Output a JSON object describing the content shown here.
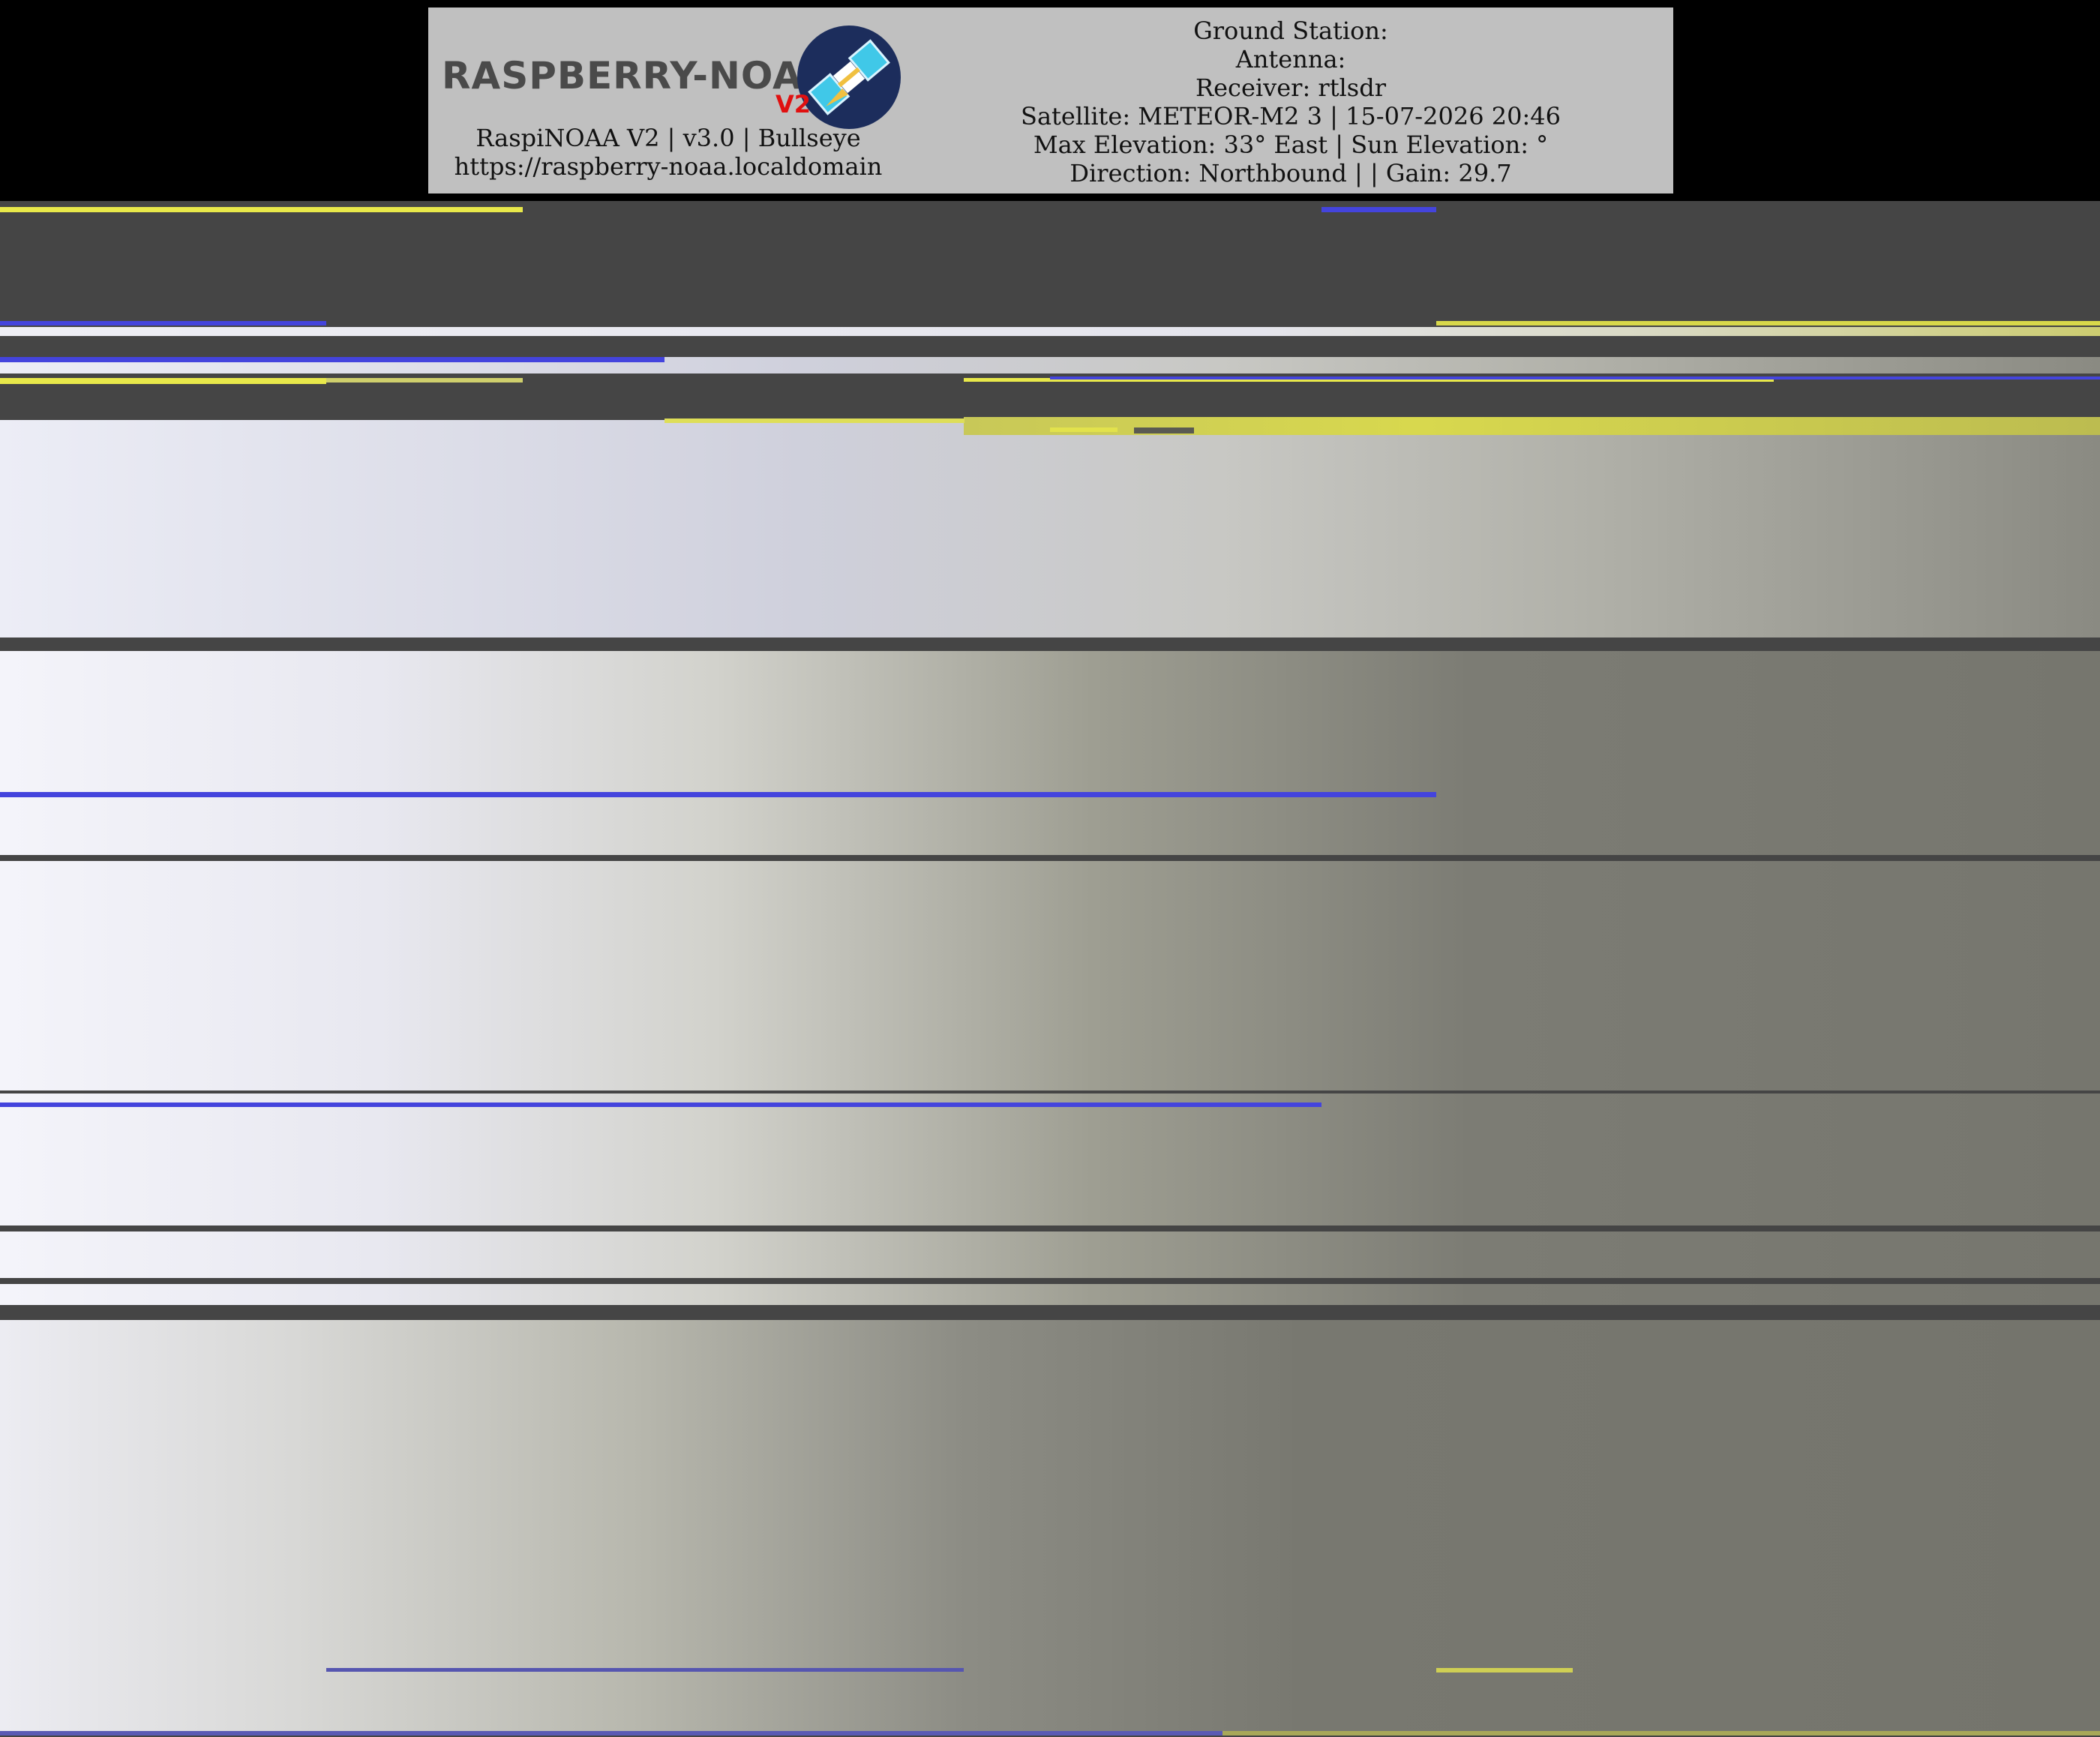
{
  "header": {
    "logo_text": "RASPBERRY-NOAA",
    "logo_version": "V2",
    "software_line": "RaspiNOAA V2 | v3.0 | Bullseye",
    "url_line": "https://raspberry-noaa.localdomain",
    "ground_station": "Ground Station:",
    "antenna": "Antenna:",
    "receiver": "Receiver: rtlsdr",
    "satellite": "Satellite: METEOR-M2 3 | 15-07-2026 20:46",
    "elevation": "Max Elevation: 33° East | Sun Elevation: °",
    "direction": "Direction: Northbound | | Gain: 29.7"
  },
  "colors": {
    "background": "#000000",
    "header_bg": "#c0c0c0",
    "no_signal": "#454545",
    "noise_yellow": "#e8e84a",
    "noise_blue": "#4444dd",
    "logo_red": "#e01010",
    "logo_navy": "#1c2d5c",
    "logo_cyan": "#40c8e8"
  },
  "icons": {
    "logo_badge": "satellite-icon"
  }
}
